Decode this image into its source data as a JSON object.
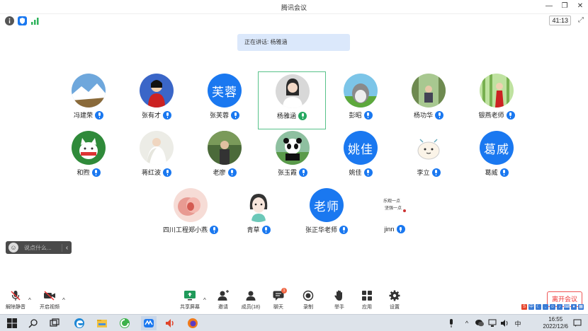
{
  "window": {
    "title": "腾讯会议",
    "timer": "41:13"
  },
  "speaking_banner": "正在讲话: 杨雅涵",
  "participants": [
    {
      "name": "冯建荣",
      "avatar": "photo",
      "mic": "blue"
    },
    {
      "name": "张有才",
      "avatar": "photo",
      "mic": "blue"
    },
    {
      "name": "张芙蓉",
      "avatar_text": "芙蓉",
      "mic": "blue"
    },
    {
      "name": "杨雅涵",
      "avatar": "photo",
      "mic": "green",
      "active": true
    },
    {
      "name": "彭昭",
      "avatar": "photo",
      "mic": "blue"
    },
    {
      "name": "杨功华",
      "avatar": "photo",
      "mic": "blue"
    },
    {
      "name": "银燕老师",
      "avatar": "photo",
      "mic": "blue"
    },
    {
      "name": "和煦",
      "avatar": "photo",
      "mic": "blue"
    },
    {
      "name": "蒋红波",
      "avatar": "photo",
      "mic": "blue"
    },
    {
      "name": "老廖",
      "avatar": "photo",
      "mic": "blue"
    },
    {
      "name": "张玉霞",
      "avatar": "photo",
      "mic": "blue"
    },
    {
      "name": "姚佳",
      "avatar_text": "姚佳",
      "mic": "blue"
    },
    {
      "name": "李立",
      "avatar": "photo",
      "mic": "blue"
    },
    {
      "name": "葛威",
      "avatar_text": "葛威",
      "mic": "blue"
    },
    {
      "name": "四川工程郑小燕",
      "avatar": "photo",
      "mic": "blue"
    },
    {
      "name": "青草",
      "avatar": "photo",
      "mic": "blue"
    },
    {
      "name": "张正华老师",
      "avatar_text": "老师",
      "mic": "blue"
    },
    {
      "name": "jinn",
      "avatar": "photo",
      "mic": "blue"
    }
  ],
  "chat": {
    "placeholder": "说点什么...",
    "collapse": "‹",
    "emoji": "☺"
  },
  "toolbar": {
    "mute": "解除静音",
    "video": "开启视频",
    "share": "共享屏幕",
    "invite": "邀请",
    "members": "成员(18)",
    "chat": "聊天",
    "chat_badge": "1",
    "record": "录制",
    "raise_hand": "举手",
    "apps": "应用",
    "settings": "设置",
    "leave": "离开会议"
  },
  "taskbar": {
    "time": "16:55",
    "date": "2022/12/6"
  },
  "colors": {
    "accent": "#1a78f0",
    "active_border": "#58c28a",
    "leave": "#e33333"
  }
}
